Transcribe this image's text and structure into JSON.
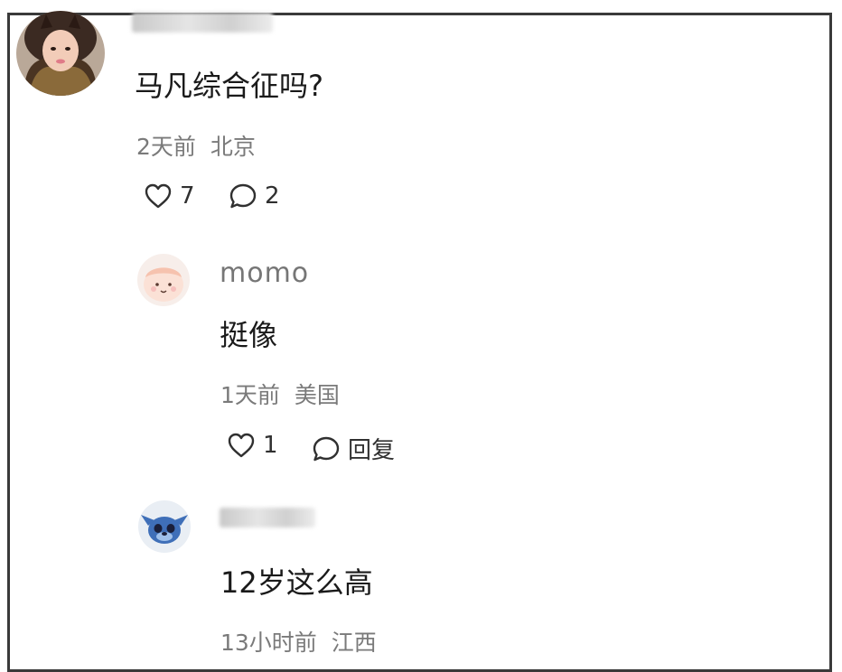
{
  "comments": [
    {
      "text": "马凡综合征吗?",
      "time": "2天前",
      "location": "北京",
      "likes": "7",
      "replies": "2"
    },
    {
      "username": "momo",
      "text": "挺像",
      "time": "1天前",
      "location": "美国",
      "likes": "1",
      "reply_label": "回复"
    },
    {
      "text": "12岁这么高",
      "time": "13小时前",
      "location": "江西"
    }
  ],
  "icons": {
    "like": "heart-icon",
    "comment": "comment-bubble-icon"
  },
  "colors": {
    "text_primary": "#1a1a1a",
    "text_secondary": "#7a7a7a",
    "username": "#767676",
    "border": "#3a3a3a"
  }
}
